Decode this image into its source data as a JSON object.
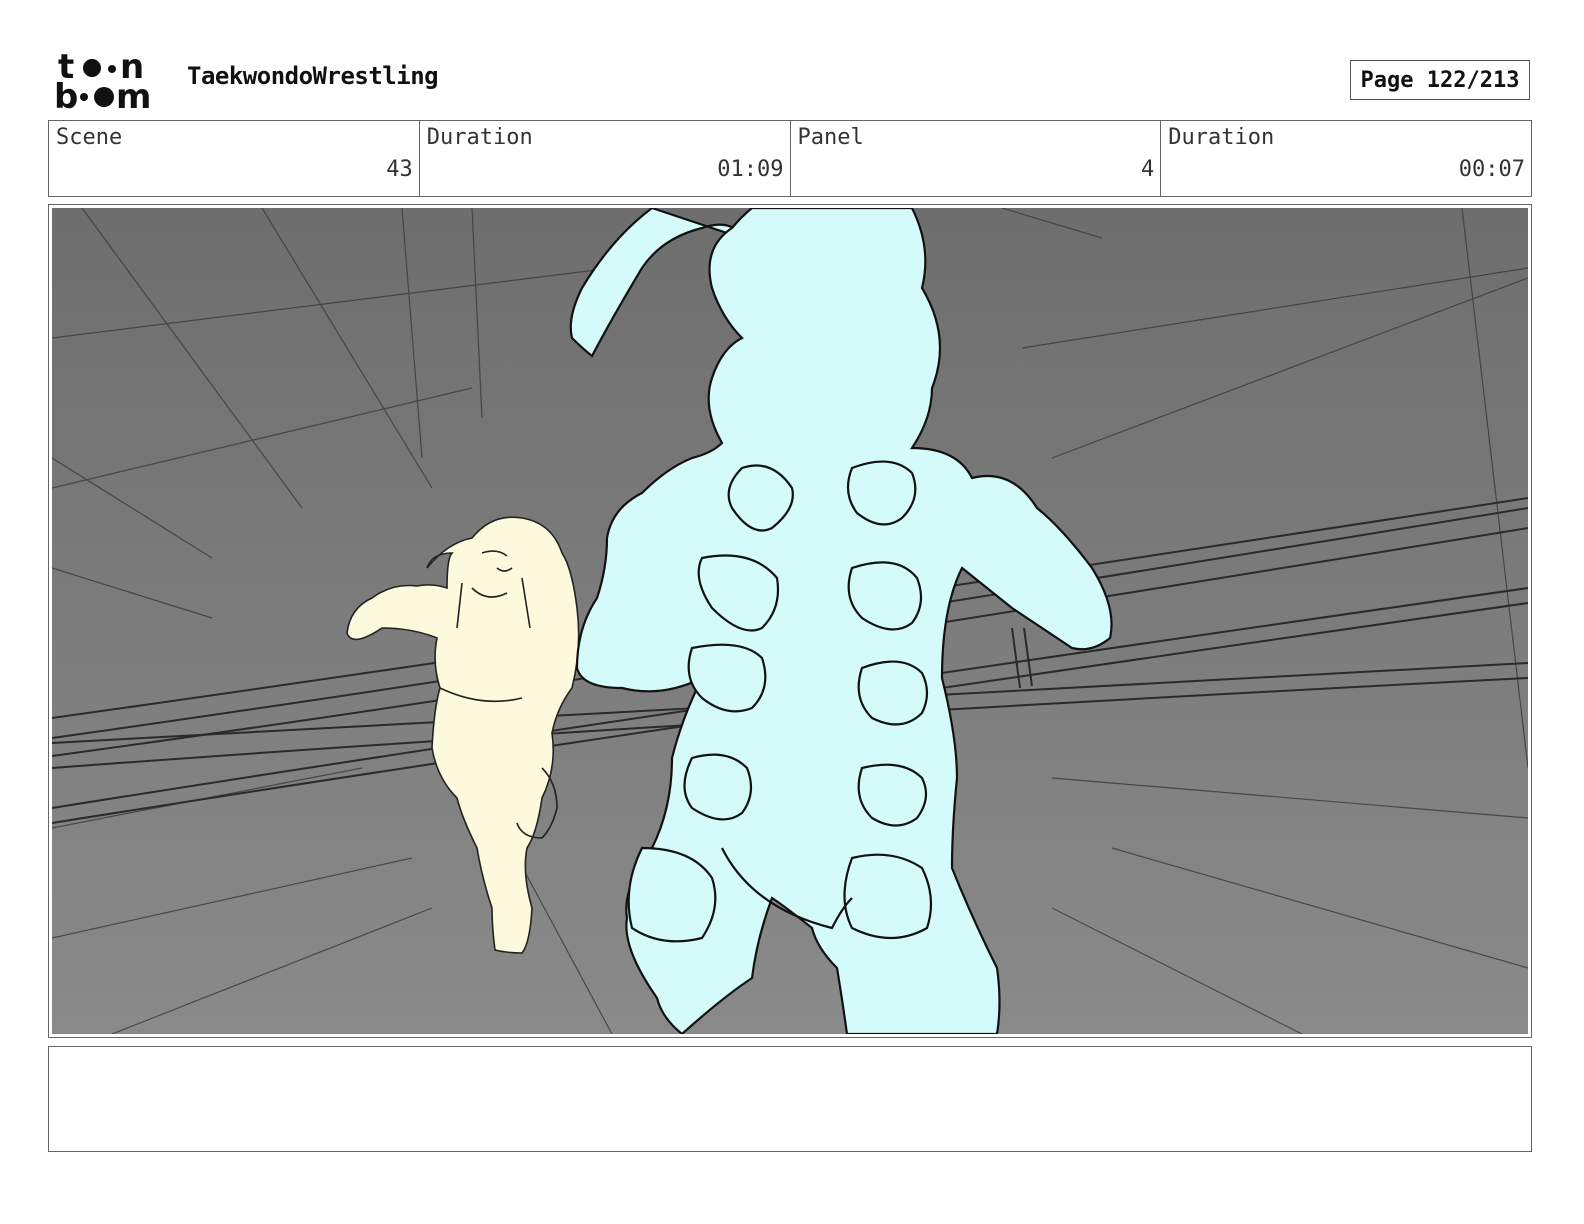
{
  "header": {
    "logo_text": "toon boom",
    "project_title": "TaekwondoWrestling",
    "page_label": "Page 122/213"
  },
  "info": {
    "scene_label": "Scene",
    "scene_value": "43",
    "scene_duration_label": "Duration",
    "scene_duration_value": "01:09",
    "panel_label": "Panel",
    "panel_value": "4",
    "panel_duration_label": "Duration",
    "panel_duration_value": "00:07"
  },
  "colors": {
    "background_gray": "#7a7a7a",
    "foreground_figure": "#d4fafa",
    "running_figure": "#fdf9dc",
    "line": "#111111"
  }
}
